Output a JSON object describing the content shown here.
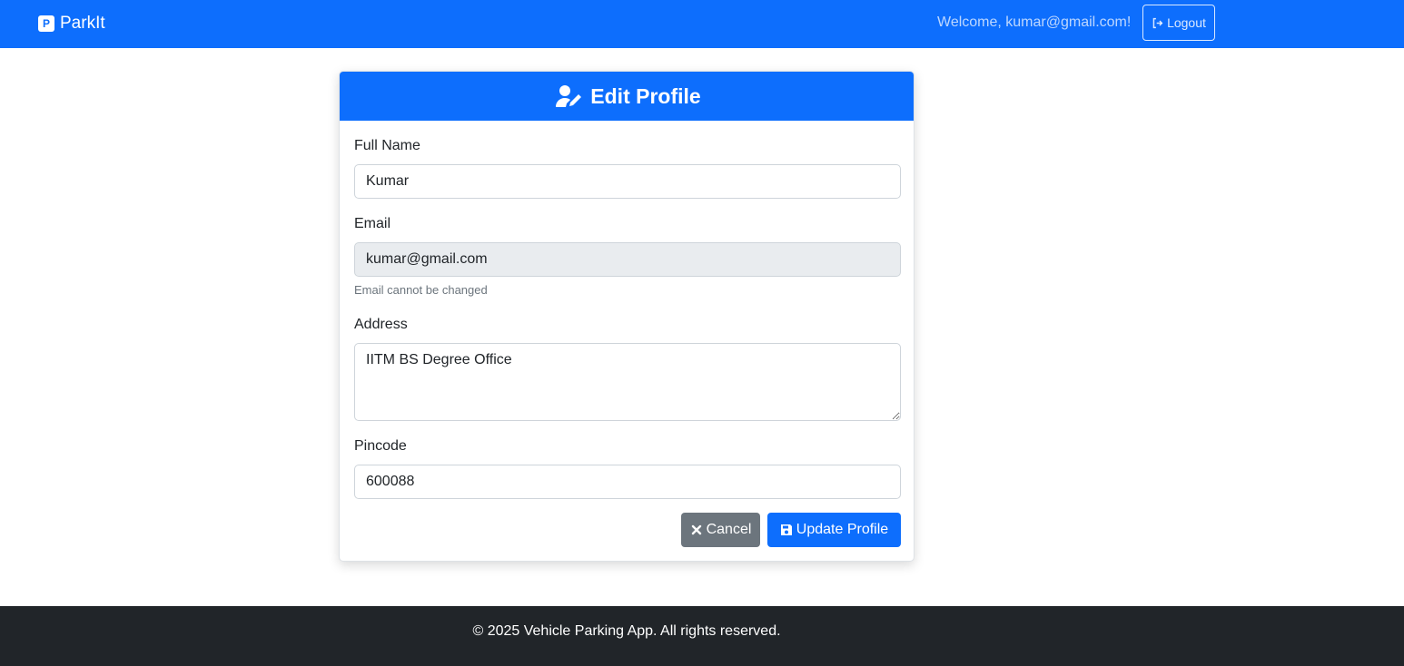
{
  "navbar": {
    "brand": "ParkIt",
    "brand_icon": "parking-icon",
    "welcome_text": "Welcome, kumar@gmail.com!",
    "logout_label": "Logout",
    "logout_icon": "sign-out-icon",
    "background": "#0d6efd"
  },
  "card": {
    "title": "Edit Profile",
    "title_icon": "user-edit-icon",
    "fields": {
      "full_name": {
        "label": "Full Name",
        "value": "Kumar"
      },
      "email": {
        "label": "Email",
        "value": "kumar@gmail.com",
        "help": "Email cannot be changed"
      },
      "address": {
        "label": "Address",
        "value": "IITM BS Degree Office"
      },
      "pincode": {
        "label": "Pincode",
        "value": "600088"
      }
    },
    "buttons": {
      "cancel_label": "Cancel",
      "cancel_icon": "close-icon",
      "update_label": "Update Profile",
      "update_icon": "save-icon"
    }
  },
  "footer": {
    "text": "© 2025 Vehicle Parking App. All rights reserved."
  },
  "colors": {
    "primary": "#0d6efd",
    "secondary": "#6c757d",
    "dark": "#212529"
  }
}
